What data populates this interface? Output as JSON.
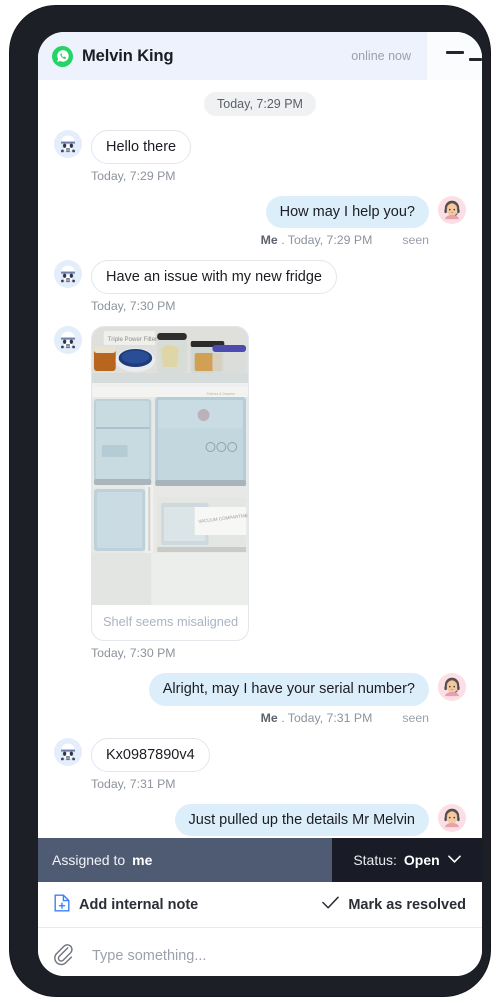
{
  "header": {
    "channel_icon": "whatsapp-icon",
    "contact_name": "Melvin King",
    "presence": "online now",
    "menu_icon": "hamburger-menu-icon"
  },
  "conversation": {
    "date_divider": "Today, 7:29 PM",
    "messages": [
      {
        "id": "m1",
        "direction": "in",
        "avatar": "customer-avatar",
        "text": "Hello there",
        "meta": "Today, 7:29 PM"
      },
      {
        "id": "m2",
        "direction": "out",
        "avatar": "agent-avatar",
        "text": "How may I help you?",
        "sender": "Me",
        "meta": ". Today, 7:29 PM",
        "receipt": "seen"
      },
      {
        "id": "m3",
        "direction": "in",
        "avatar": "customer-avatar",
        "text": "Have an issue with my new fridge",
        "meta": "Today, 7:30 PM"
      },
      {
        "id": "m4",
        "direction": "in",
        "avatar": "customer-avatar",
        "type": "image",
        "image_label_top": "Triple Power Filter",
        "image_label_bottom": "VACUUM COMPARTMENT",
        "caption": "Shelf seems misaligned",
        "meta": "Today, 7:30 PM"
      },
      {
        "id": "m5",
        "direction": "out",
        "avatar": "agent-avatar",
        "text": "Alright, may I have your serial number?",
        "sender": "Me",
        "meta": ". Today, 7:31 PM",
        "receipt": "seen"
      },
      {
        "id": "m6",
        "direction": "in",
        "avatar": "customer-avatar",
        "text": "Kx0987890v4",
        "meta": "Today, 7:31 PM"
      },
      {
        "id": "m7",
        "direction": "out",
        "avatar": "agent-avatar",
        "text": "Just pulled up the details Mr Melvin"
      }
    ]
  },
  "ticket_bar": {
    "assigned_label": "Assigned to",
    "assignee": "me",
    "status_label": "Status:",
    "status_value": "Open",
    "status_chevron": "chevron-down-icon"
  },
  "action_bar": {
    "add_note_icon": "note-add-icon",
    "add_note_label": "Add internal note",
    "resolve_icon": "check-icon",
    "resolve_label": "Mark as resolved"
  },
  "composer": {
    "attach_icon": "paperclip-icon",
    "placeholder": "Type something...",
    "value": ""
  },
  "colors": {
    "header_bg": "#eef2fc",
    "whatsapp_green": "#25d366",
    "outgoing_bubble": "#ddeefb",
    "assignee_bar": "#4f5b73",
    "status_bar": "#191c26",
    "accent_blue": "#3b82f6"
  }
}
